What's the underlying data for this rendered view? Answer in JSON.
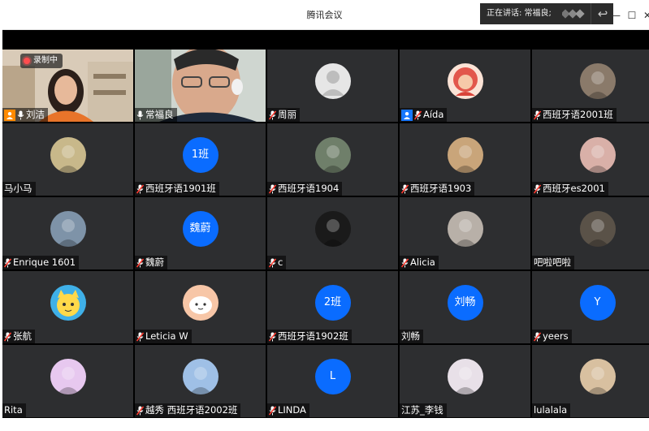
{
  "window": {
    "title": "腾讯会议",
    "speaking_label": "正在讲话: 常福良;",
    "minimize_glyph": "—",
    "maximize_glyph": "☐",
    "close_glyph": "✕"
  },
  "recording": {
    "label": "录制中"
  },
  "participants": [
    {
      "name": "刘洁",
      "kind": "video-woman",
      "host": true,
      "mic": "on"
    },
    {
      "name": "常福良",
      "kind": "video-man",
      "mic": "on",
      "speaking": true
    },
    {
      "name": "周丽",
      "kind": "avatar-default",
      "mic": "muted"
    },
    {
      "name": "Aída",
      "kind": "avatar-redhair",
      "cohost": true,
      "mic": "muted"
    },
    {
      "name": "西班牙语2001班",
      "kind": "avatar-photo",
      "mic": "muted",
      "color": "#8a7a6a"
    },
    {
      "name": "马小马",
      "kind": "avatar-photo",
      "mic": "none",
      "color": "#c8b88a"
    },
    {
      "name": "西班牙语1901班",
      "kind": "initials",
      "initials": "1班",
      "mic": "muted"
    },
    {
      "name": "西班牙语1904",
      "kind": "avatar-photo",
      "mic": "muted",
      "color": "#6f7f6a"
    },
    {
      "name": "西班牙语1903",
      "kind": "avatar-photo",
      "mic": "muted",
      "color": "#c9a57a"
    },
    {
      "name": "西班牙es2001",
      "kind": "avatar-photo",
      "mic": "muted",
      "color": "#d9b0a8"
    },
    {
      "name": "Enrique 1601",
      "kind": "avatar-photo",
      "mic": "muted",
      "color": "#7e93a8"
    },
    {
      "name": "魏蔚",
      "kind": "initials",
      "initials": "魏蔚",
      "mic": "muted"
    },
    {
      "name": "c",
      "kind": "avatar-photo",
      "mic": "muted",
      "color": "#1a1a1a"
    },
    {
      "name": "Alicia",
      "kind": "avatar-photo",
      "mic": "muted",
      "color": "#b8b0a8"
    },
    {
      "name": "吧啦吧啦",
      "kind": "avatar-photo",
      "mic": "none",
      "color": "#5a5248"
    },
    {
      "name": "张航",
      "kind": "avatar-cat",
      "mic": "muted"
    },
    {
      "name": "Leticia W",
      "kind": "avatar-cartoon",
      "mic": "muted"
    },
    {
      "name": "西班牙语1902班",
      "kind": "initials",
      "initials": "2班",
      "mic": "muted"
    },
    {
      "name": "刘畅",
      "kind": "initials",
      "initials": "刘畅",
      "mic": "none"
    },
    {
      "name": "yeers",
      "kind": "initials",
      "initials": "Y",
      "mic": "muted"
    },
    {
      "name": "Rita",
      "kind": "avatar-photo",
      "mic": "none",
      "color": "#e7c8ef"
    },
    {
      "name": "越秀 西班牙语2002班",
      "kind": "avatar-photo",
      "mic": "muted",
      "color": "#9fc0e6"
    },
    {
      "name": "LINDA",
      "kind": "initials",
      "initials": "L",
      "mic": "muted"
    },
    {
      "name": "江苏_李钱",
      "kind": "avatar-photo",
      "mic": "none",
      "color": "#e8e0e8"
    },
    {
      "name": "lulalala",
      "kind": "avatar-photo",
      "mic": "none",
      "color": "#d8c0a0"
    }
  ]
}
